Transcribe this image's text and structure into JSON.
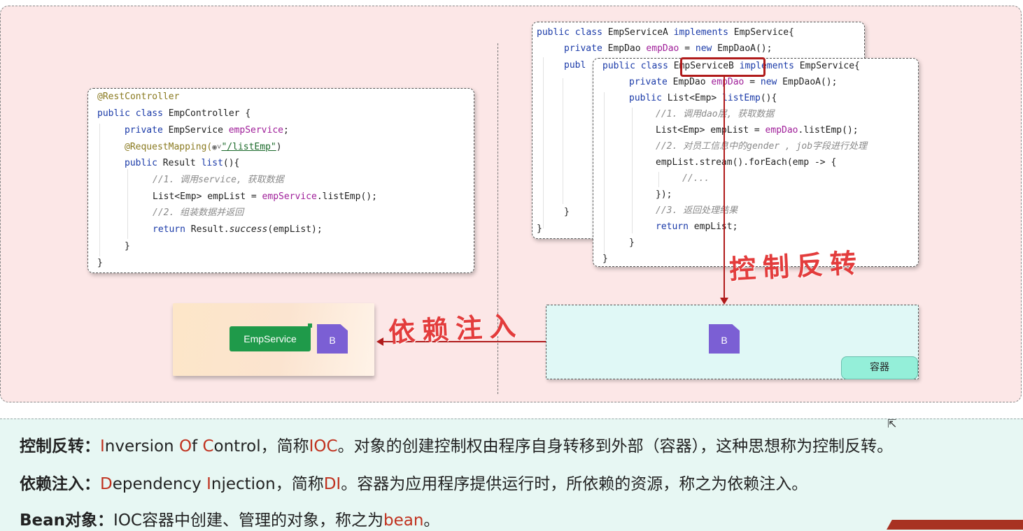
{
  "controller_code": {
    "l1": "@RestController",
    "l2a": "public class",
    "l2b": " EmpController {",
    "l3a": "private",
    "l3b": " EmpService ",
    "l3c": "empService",
    "l3d": ";",
    "l4a": "@RequestMapping(",
    "l4b": "◉˅",
    "l4c": "\"/listEmp\"",
    "l4d": ")",
    "l5a": "public",
    "l5b": " Result ",
    "l5c": "list",
    "l5d": "(){",
    "l6": "//1. 调用service, 获取数据",
    "l7a": "List<Emp> empList = ",
    "l7b": "empService",
    "l7c": ".listEmp();",
    "l8": "//2. 组装数据并返回",
    "l9a": "return",
    "l9b": " Result.",
    "l9c": "success",
    "l9d": "(empList);",
    "l10": "}",
    "l11": "}"
  },
  "service_a_code": {
    "l1a": "public class",
    "l1b": " EmpServiceA ",
    "l1c": "implements",
    "l1d": " EmpService{",
    "l2a": "private",
    "l2b": " EmpDao ",
    "l2c": "empDao",
    "l2d": " = ",
    "l2e": "new",
    "l2f": " EmpDaoA();",
    "l3": "publ",
    "l4": "}",
    "l5": "}"
  },
  "service_b_code": {
    "l1a": "public class",
    "l1b": " EmpServiceB ",
    "l1c": "implements",
    "l1d": " EmpService{",
    "l2a": "private",
    "l2b": " EmpDao ",
    "l2c": "empDao",
    "l2d": " = ",
    "l2e": "new",
    "l2f": " EmpDaoA();",
    "l3a": "public",
    "l3b": " List<Emp> ",
    "l3c": "listEmp",
    "l3d": "(){",
    "l4": "//1. 调用dao层, 获取数据",
    "l5a": "List<Emp> empList = ",
    "l5b": "empDao",
    "l5c": ".listEmp();",
    "l6": "//2. 对员工信息中的gender , job字段进行处理",
    "l7": "empList.stream().forEach(emp -> {",
    "l8": "//...",
    "l9": "});",
    "l10": "//3. 返回处理结果",
    "l11a": "return",
    "l11b": " empList;",
    "l12": "}",
    "l13": "}"
  },
  "labels": {
    "ioc_handwritten": "控制反转",
    "di_handwritten": "依赖注入",
    "emp_service_tag": "EmpService",
    "bean_left": "B",
    "bean_container": "B",
    "container": "容器"
  },
  "definitions": {
    "ioc": {
      "term": "控制反转：",
      "p1": "I",
      "p2": "nversion ",
      "p3": "O",
      "p4": "f ",
      "p5": "C",
      "p6": "ontrol，简称",
      "p7": "IOC",
      "p8": "。对象的创建控制权由程序自身转移到外部（容器），这种思想称为控制反转。"
    },
    "di": {
      "term": "依赖注入：",
      "p1": "D",
      "p2": "ependency ",
      "p3": "I",
      "p4": "njection，简称",
      "p5": "DI",
      "p6": "。容器为应用程序提供运行时，所依赖的资源，称之为依赖注入。"
    },
    "bean": {
      "term": "Bean对象：",
      "p1": "IOC容器中创建、管理的对象，称之为",
      "p2": "bean",
      "p3": "。"
    }
  },
  "colors": {
    "top_background": "#fce7e7",
    "bottom_background": "#e7f7f3",
    "highlight_red": "#c0311e",
    "service_green": "#1f9a4a",
    "bean_purple": "#7b5fd4"
  }
}
